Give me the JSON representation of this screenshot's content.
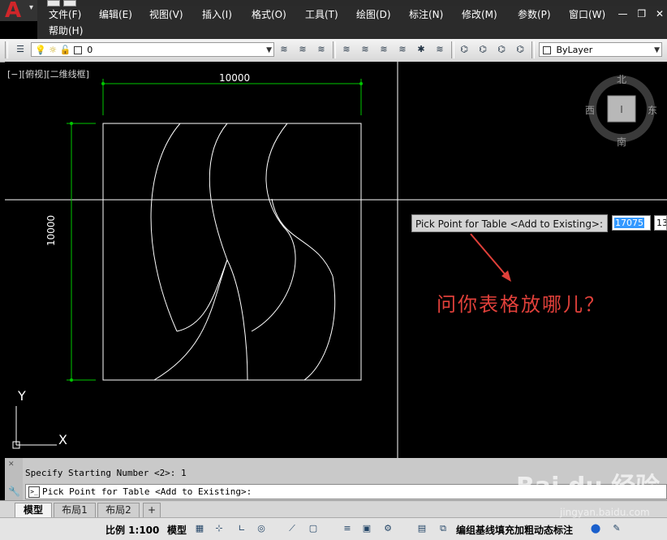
{
  "menu": {
    "items": [
      "文件(F)",
      "编辑(E)",
      "视图(V)",
      "插入(I)",
      "格式(O)",
      "工具(T)",
      "绘图(D)",
      "标注(N)",
      "修改(M)",
      "参数(P)",
      "窗口(W)",
      "帮助(H)"
    ],
    "window_controls": [
      "—",
      "❐",
      "✕"
    ]
  },
  "toolbar": {
    "layer_value": "0",
    "linetype_value": "ByLayer"
  },
  "viewport": {
    "label": "[−][俯视][二维线框]",
    "dim_horizontal": "10000",
    "dim_vertical": "10000",
    "ucs_x": "X",
    "ucs_y": "Y"
  },
  "viewcube": {
    "north": "北",
    "south": "南",
    "east": "东",
    "west": "西"
  },
  "tooltip": {
    "prompt": "Pick Point for Table <Add to Existing>:",
    "value": "17075",
    "value2": "13"
  },
  "annotation": "问你表格放哪儿？",
  "command": {
    "history": "Specify Starting Number <2>: 1",
    "current": "Pick Point for Table <Add to Existing>:"
  },
  "tabs": [
    "模型",
    "布局1",
    "布局2"
  ],
  "tabs_add": "+",
  "status": {
    "scale": "比例 1:100",
    "model": "模型",
    "right_text": "编组基线填充加粗动态标注"
  },
  "watermark": {
    "brand": "Bai du 经验",
    "url": "jingyan.baidu.com"
  },
  "colors": {
    "dimension": "#00c800",
    "geometry": "#ffffff",
    "annotation": "#e0403a"
  }
}
